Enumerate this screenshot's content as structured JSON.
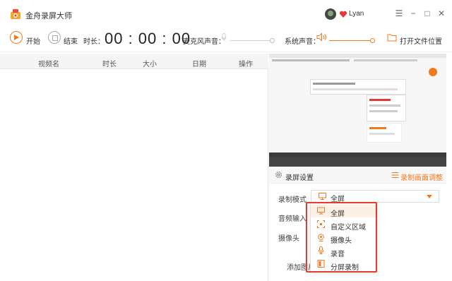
{
  "app": {
    "title": "金舟录屏大师"
  },
  "user": {
    "name": "Lyan"
  },
  "window": {
    "menu": "☰",
    "minimize": "−",
    "maximize": "□",
    "close": "✕"
  },
  "toolbar": {
    "start_label": "开始",
    "stop_label": "结束",
    "duration_label": "时长：",
    "timer": "00 : 00 : 00",
    "mic_label": "麦克风声音：",
    "system_label": "系统声音：",
    "open_folder_label": "打开文件位置"
  },
  "list": {
    "columns": [
      "视频名",
      "时长",
      "大小",
      "日期",
      "操作"
    ]
  },
  "settings": {
    "title": "录屏设置",
    "adjust_link": "录制画面调整",
    "mode_label": "录制模式",
    "audio_label": "音频输入",
    "camera_label": "摄像头",
    "add_image_label": "添加图片",
    "mode_value": "全屏",
    "mode_options": [
      {
        "label": "全屏",
        "icon": "monitor-icon"
      },
      {
        "label": "自定义区域",
        "icon": "region-icon"
      },
      {
        "label": "摄像头",
        "icon": "camera-icon"
      },
      {
        "label": "录音",
        "icon": "mic-icon"
      },
      {
        "label": "分屏录制",
        "icon": "split-screen-icon"
      }
    ]
  },
  "colors": {
    "accent": "#f07a20",
    "highlight": "#e53935"
  }
}
